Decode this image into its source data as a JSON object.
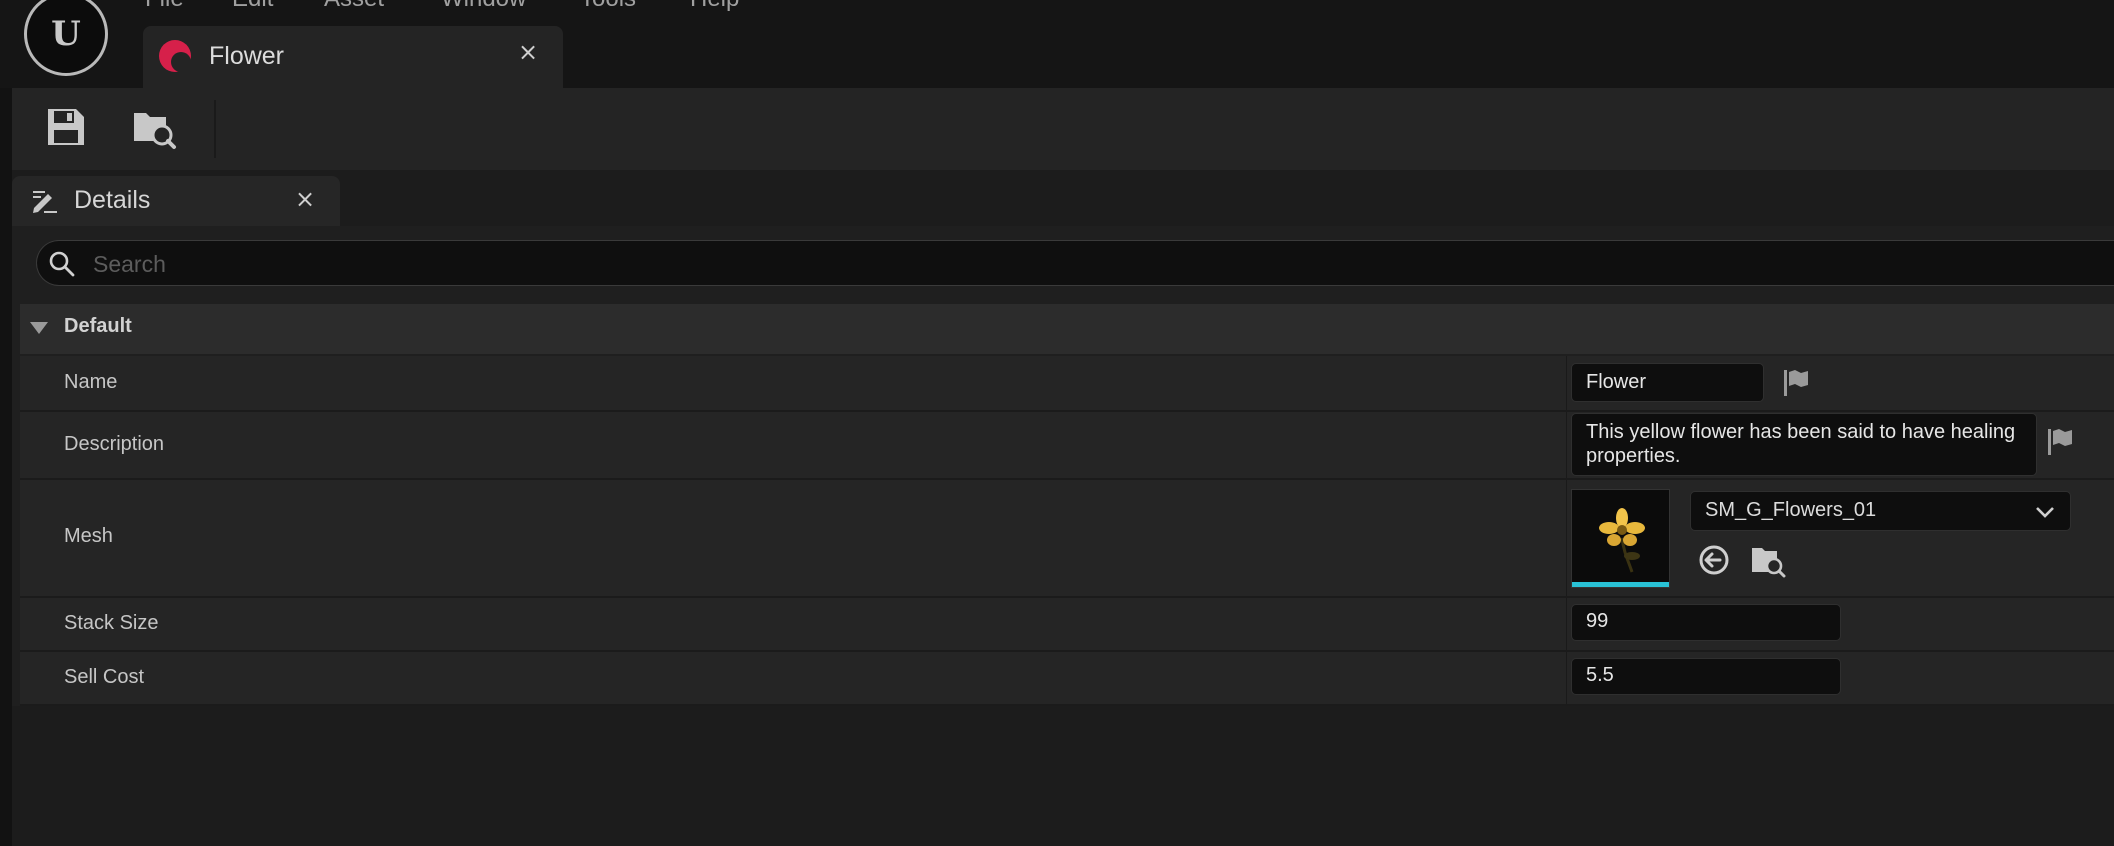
{
  "menu": [
    "File",
    "Edit",
    "Asset",
    "Window",
    "Tools",
    "Help"
  ],
  "asset_tab": {
    "label": "Flower",
    "close": "×"
  },
  "toolbar": {
    "save_icon": "save-icon",
    "browse_icon": "browse-to-asset-icon"
  },
  "details_tab": {
    "label": "Details",
    "close": "×",
    "icon": "edit-pencil-icon"
  },
  "search": {
    "placeholder": "Search",
    "value": ""
  },
  "category": {
    "label": "Default",
    "expanded": true
  },
  "properties": {
    "name": {
      "label": "Name",
      "value": "Flower"
    },
    "description": {
      "label": "Description",
      "value": "This yellow flower has been said to have healing properties."
    },
    "mesh": {
      "label": "Mesh",
      "value": "SM_G_Flowers_01"
    },
    "stack_size": {
      "label": "Stack Size",
      "value": "99"
    },
    "sell_cost": {
      "label": "Sell Cost",
      "value": "5.5"
    }
  },
  "colors": {
    "accent_cyan": "#29c2d6",
    "asset_icon": "#d6204a",
    "background": "#151515",
    "panel": "#252525"
  }
}
